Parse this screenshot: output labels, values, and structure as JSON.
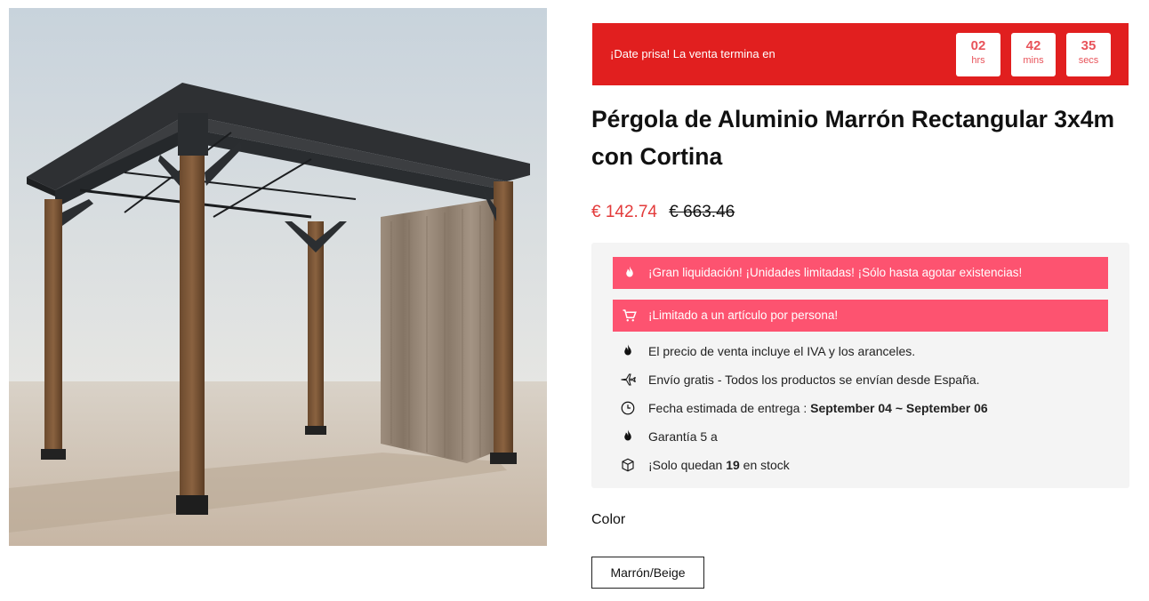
{
  "product": {
    "image_alt": "Pérgola de aluminio marrón con cortina",
    "title": "Pérgola de Aluminio Marrón Rectangular 3x4m con Cortina",
    "sale_price": "€ 142.74",
    "original_price": "€ 663.46"
  },
  "countdown": {
    "label": "¡Date prisa! La venta termina en",
    "hours": "02",
    "hours_unit": "hrs",
    "minutes": "42",
    "minutes_unit": "mins",
    "seconds": "35",
    "seconds_unit": "secs"
  },
  "alerts": [
    {
      "icon": "fire-icon",
      "text": "¡Gran liquidación! ¡Unidades limitadas! ¡Sólo hasta agotar existencias!"
    },
    {
      "icon": "cart-icon",
      "text": "¡Limitado a un artículo por persona!"
    }
  ],
  "features": {
    "tax": {
      "icon": "fire-icon",
      "text": "El precio de venta incluye el IVA y los aranceles."
    },
    "shipping": {
      "icon": "plane-icon",
      "text": "Envío gratis - Todos los productos se envían desde España."
    },
    "delivery": {
      "icon": "clock-icon",
      "label": "Fecha estimada de entrega : ",
      "dates": "September 04 ~ September 06"
    },
    "warranty": {
      "icon": "fire-icon",
      "text": "Garantía 5 a"
    },
    "stock": {
      "icon": "box-icon",
      "prefix": "¡Solo quedan ",
      "count": "19",
      "suffix": " en stock"
    }
  },
  "variant": {
    "label": "Color",
    "selected": "Marrón/Beige"
  },
  "colors": {
    "countdown_bg": "#e11f1f",
    "alert_bg": "#fd5370",
    "sale_price": "#e33b3b",
    "panel_bg": "#f4f4f4"
  }
}
